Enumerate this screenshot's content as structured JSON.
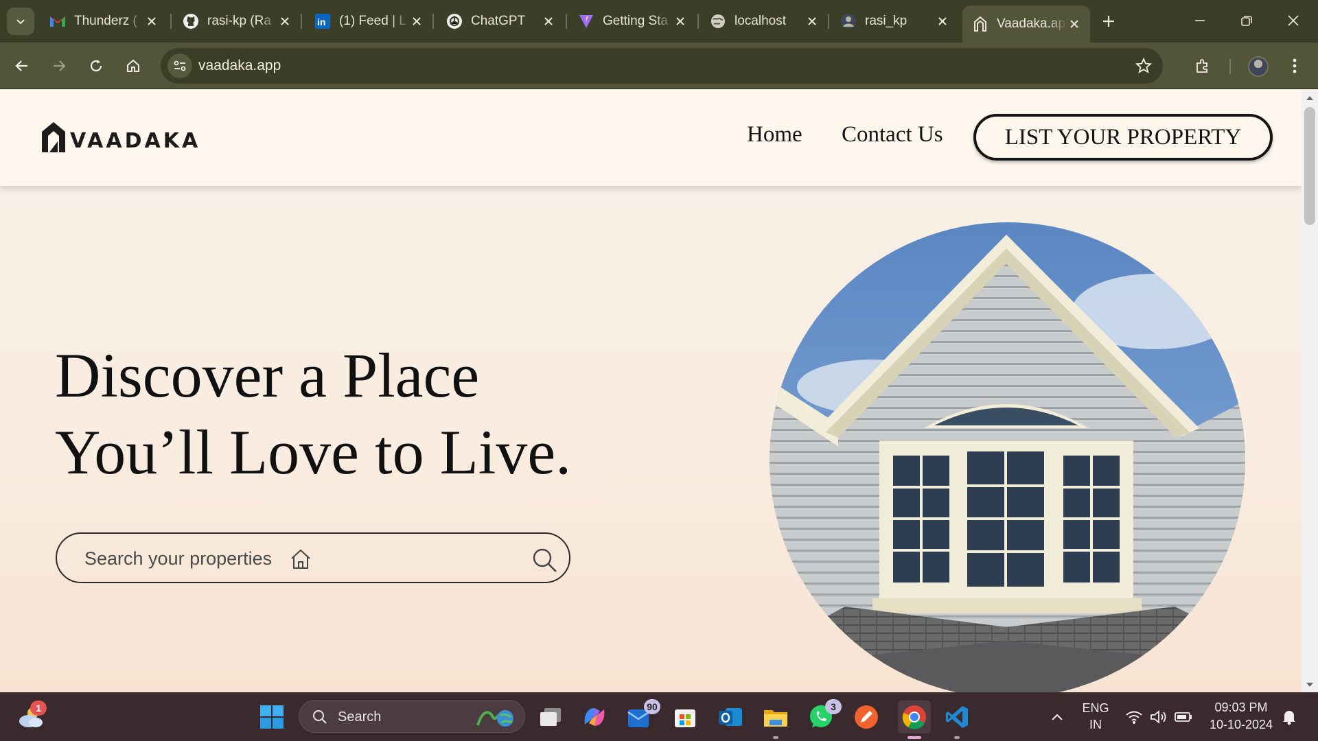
{
  "browser": {
    "tabs": [
      {
        "title": "Thunderz (",
        "icon": "gmail-icon"
      },
      {
        "title": "rasi-kp (Ra",
        "icon": "github-icon"
      },
      {
        "title": "(1) Feed | L",
        "icon": "linkedin-icon"
      },
      {
        "title": "ChatGPT",
        "icon": "chatgpt-icon"
      },
      {
        "title": "Getting Sta",
        "icon": "vite-icon"
      },
      {
        "title": "localhost",
        "icon": "globe-icon"
      },
      {
        "title": "rasi_kp",
        "icon": "profile-icon"
      },
      {
        "title": "Vaadaka.ap",
        "icon": "vaadaka-icon",
        "active": true
      }
    ],
    "url": "vaadaka.app",
    "accent": "#52553a"
  },
  "site": {
    "logo_text": "VAADAKA",
    "nav": {
      "home": "Home",
      "contact": "Contact Us",
      "list_property": "LIST YOUR PROPERTY"
    },
    "hero": {
      "line1": "Discover a Place",
      "line2": "You’ll Love to Live."
    },
    "search": {
      "placeholder": "Search your properties"
    }
  },
  "taskbar": {
    "search_label": "Search",
    "weather_badge": "1",
    "outlook_badge": "90",
    "whatsapp_badge": "3",
    "language": "ENG",
    "region": "IN",
    "time": "09:03 PM",
    "date": "10-10-2024"
  }
}
